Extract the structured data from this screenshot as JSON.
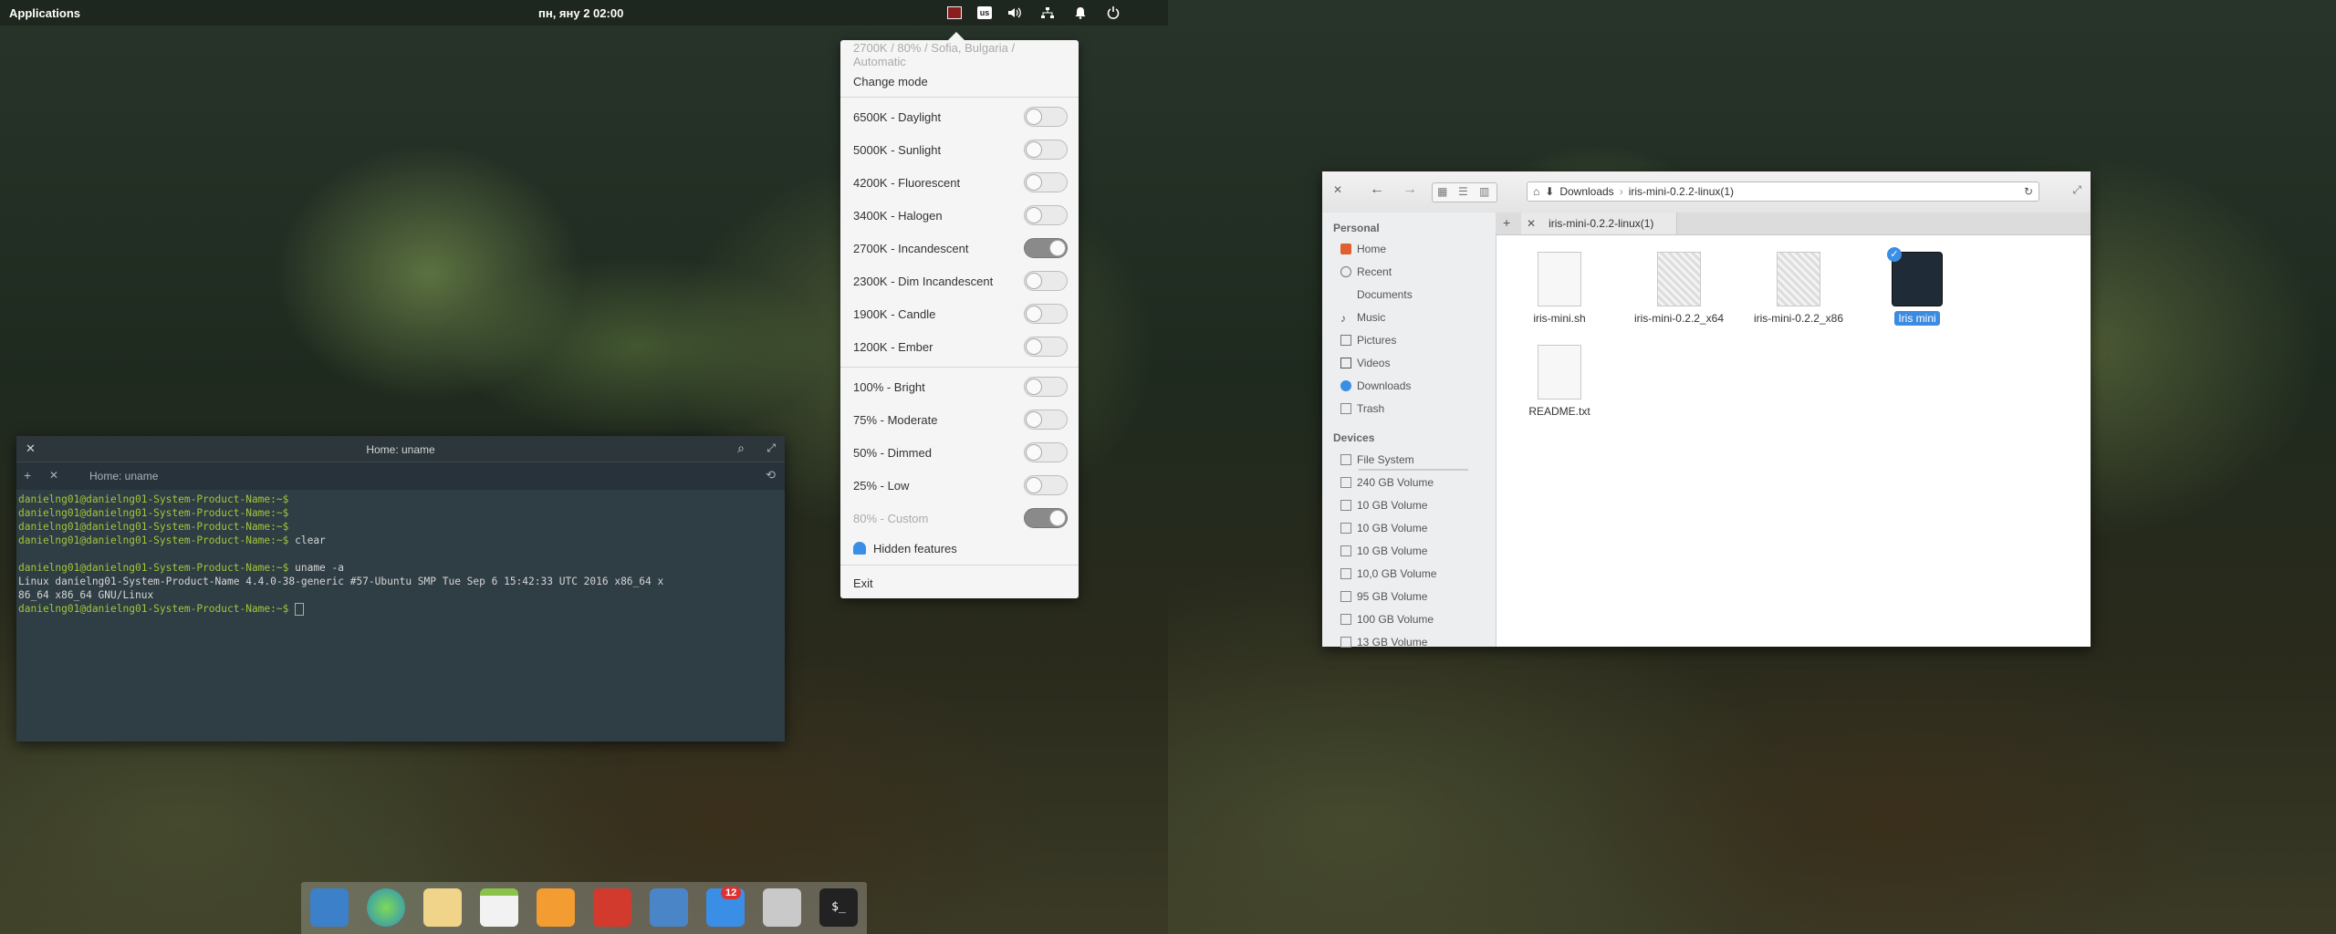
{
  "topbar": {
    "applications": "Applications",
    "clock": "пн, яну  2   02:00",
    "keyboard_layout": "us"
  },
  "icons": {
    "night_light": "red-screen-indicator-icon",
    "volume": "volume-icon",
    "network": "network-icon",
    "notifications": "bell-icon",
    "power": "power-icon"
  },
  "popover": {
    "status": "2700K / 80% / Sofia, Bulgaria / Automatic",
    "change_mode": "Change mode",
    "temperatures": [
      {
        "label": "6500K - Daylight",
        "on": false
      },
      {
        "label": "5000K - Sunlight",
        "on": false
      },
      {
        "label": "4200K - Fluorescent",
        "on": false
      },
      {
        "label": "3400K - Halogen",
        "on": false
      },
      {
        "label": "2700K - Incandescent",
        "on": true
      },
      {
        "label": "2300K - Dim Incandescent",
        "on": false
      },
      {
        "label": "1900K - Candle",
        "on": false
      },
      {
        "label": "1200K - Ember",
        "on": false
      }
    ],
    "brightness": [
      {
        "label": "100% - Bright",
        "on": false
      },
      {
        "label": "75% - Moderate",
        "on": false
      },
      {
        "label": "50% - Dimmed",
        "on": false
      },
      {
        "label": "25% - Low",
        "on": false
      },
      {
        "label": "80% - Custom",
        "on": true
      }
    ],
    "hidden_features": "Hidden features",
    "exit": "Exit"
  },
  "terminal": {
    "title": "Home: uname",
    "tab": "Home: uname",
    "prompt": "danielng01@danielng01-System-Product-Name:~$",
    "cmd_clear": " clear",
    "cmd_uname": " uname -a",
    "output_1": "Linux danielng01-System-Product-Name 4.4.0-38-generic #57-Ubuntu SMP Tue Sep 6 15:42:33 UTC 2016 x86_64 x",
    "output_2": "86_64 x86_64 GNU/Linux"
  },
  "dock": {
    "badge": "12"
  },
  "files": {
    "breadcrumb": [
      "Downloads",
      "iris-mini-0.2.2-linux(1)"
    ],
    "tab": "iris-mini-0.2.2-linux(1)",
    "personal_header": "Personal",
    "personal": [
      "Home",
      "Recent",
      "Documents",
      "Music",
      "Pictures",
      "Videos",
      "Downloads",
      "Trash"
    ],
    "devices_header": "Devices",
    "devices": [
      "File System",
      "240 GB Volume",
      "10 GB Volume",
      "10 GB Volume",
      "10 GB Volume",
      "10,0 GB Volume",
      "95 GB Volume",
      "100 GB Volume",
      "13 GB Volume"
    ],
    "items": [
      "iris-mini.sh",
      "iris-mini-0.2.2_x64",
      "iris-mini-0.2.2_x86",
      "Iris mini",
      "README.txt"
    ]
  }
}
